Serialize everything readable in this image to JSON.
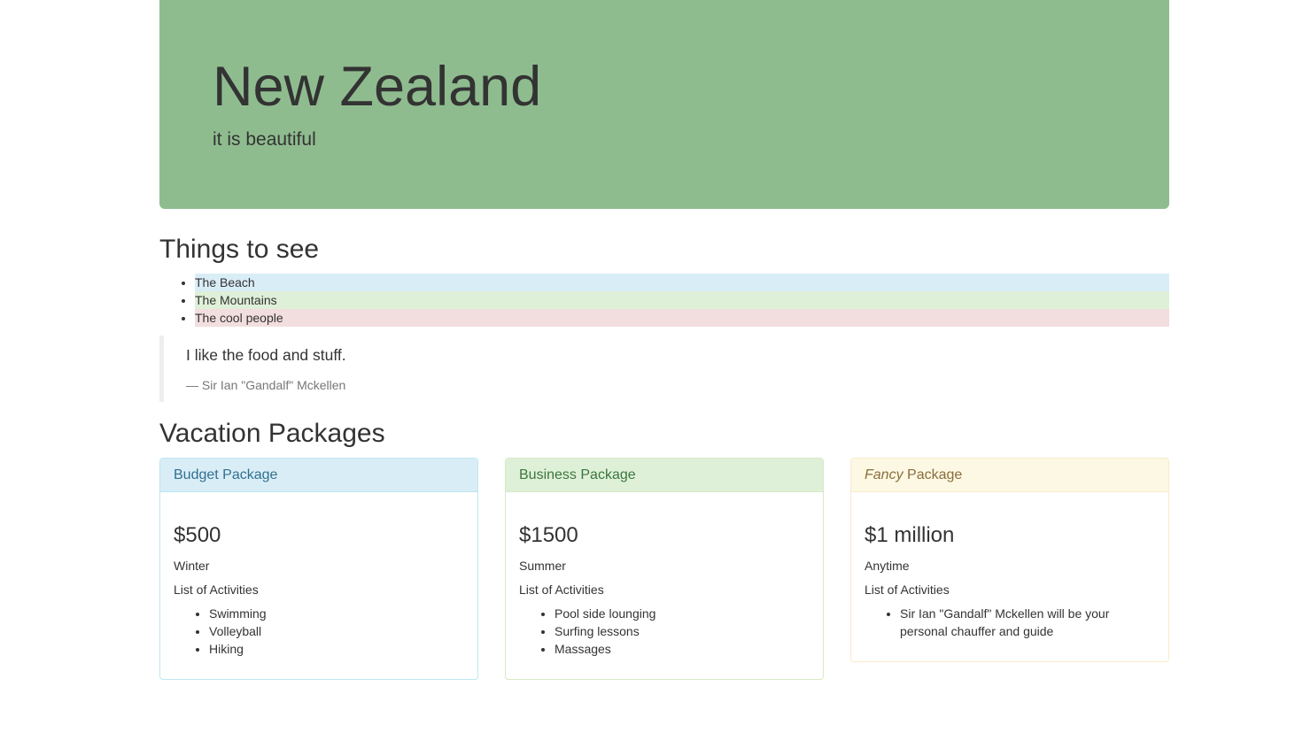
{
  "jumbotron": {
    "title": "New Zealand",
    "subtitle": "it is beautiful",
    "background": "#8fbc8f"
  },
  "things_to_see": {
    "heading": "Things to see",
    "items": [
      {
        "label": "The Beach",
        "color": "#d9edf7"
      },
      {
        "label": "The Mountains",
        "color": "#dff0d8"
      },
      {
        "label": "The cool people",
        "color": "#f2dede"
      }
    ]
  },
  "quote": {
    "text": "I like the food and stuff.",
    "author": "— Sir Ian \"Gandalf\" Mckellen"
  },
  "packages": {
    "heading": "Vacation Packages",
    "activities_label": "List of Activities",
    "items": [
      {
        "title": "Budget Package",
        "price": "$500",
        "season": "Winter",
        "activities": [
          "Swimming",
          "Volleyball",
          "Hiking"
        ]
      },
      {
        "title": "Business Package",
        "price": "$1500",
        "season": "Summer",
        "activities": [
          "Pool side lounging",
          "Surfing lessons",
          "Massages"
        ]
      },
      {
        "title_em": "Fancy",
        "title_rest": " Package",
        "price": "$1 million",
        "season": "Anytime",
        "activities": [
          "Sir Ian \"Gandalf\" Mckellen will be your personal chauffer and guide"
        ]
      }
    ]
  }
}
